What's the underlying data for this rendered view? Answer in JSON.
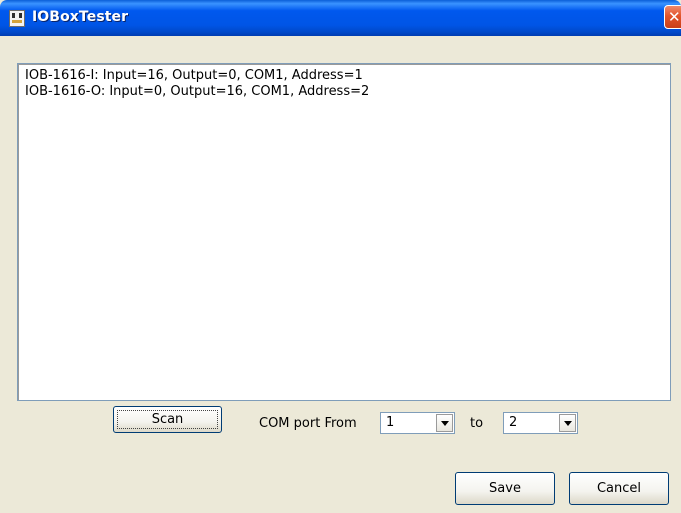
{
  "window": {
    "title": "IOBoxTester",
    "app_icon": "io-box-app-icon",
    "close_glyph": "✕"
  },
  "device_list": {
    "lines": [
      "IOB-1616-I: Input=16, Output=0, COM1, Address=1",
      "IOB-1616-O: Input=0, Output=16, COM1, Address=2"
    ]
  },
  "controls": {
    "scan_label": "Scan",
    "com_port_from_label": "COM port From",
    "com_from_value": "1",
    "to_label": "to",
    "com_to_value": "2",
    "dropdown_icon": "chevron-down-icon"
  },
  "footer": {
    "save_label": "Save",
    "cancel_label": "Cancel"
  },
  "colors": {
    "titlebar": "#0055e6",
    "close_button": "#e2542b",
    "window_background": "#ece9d8"
  }
}
